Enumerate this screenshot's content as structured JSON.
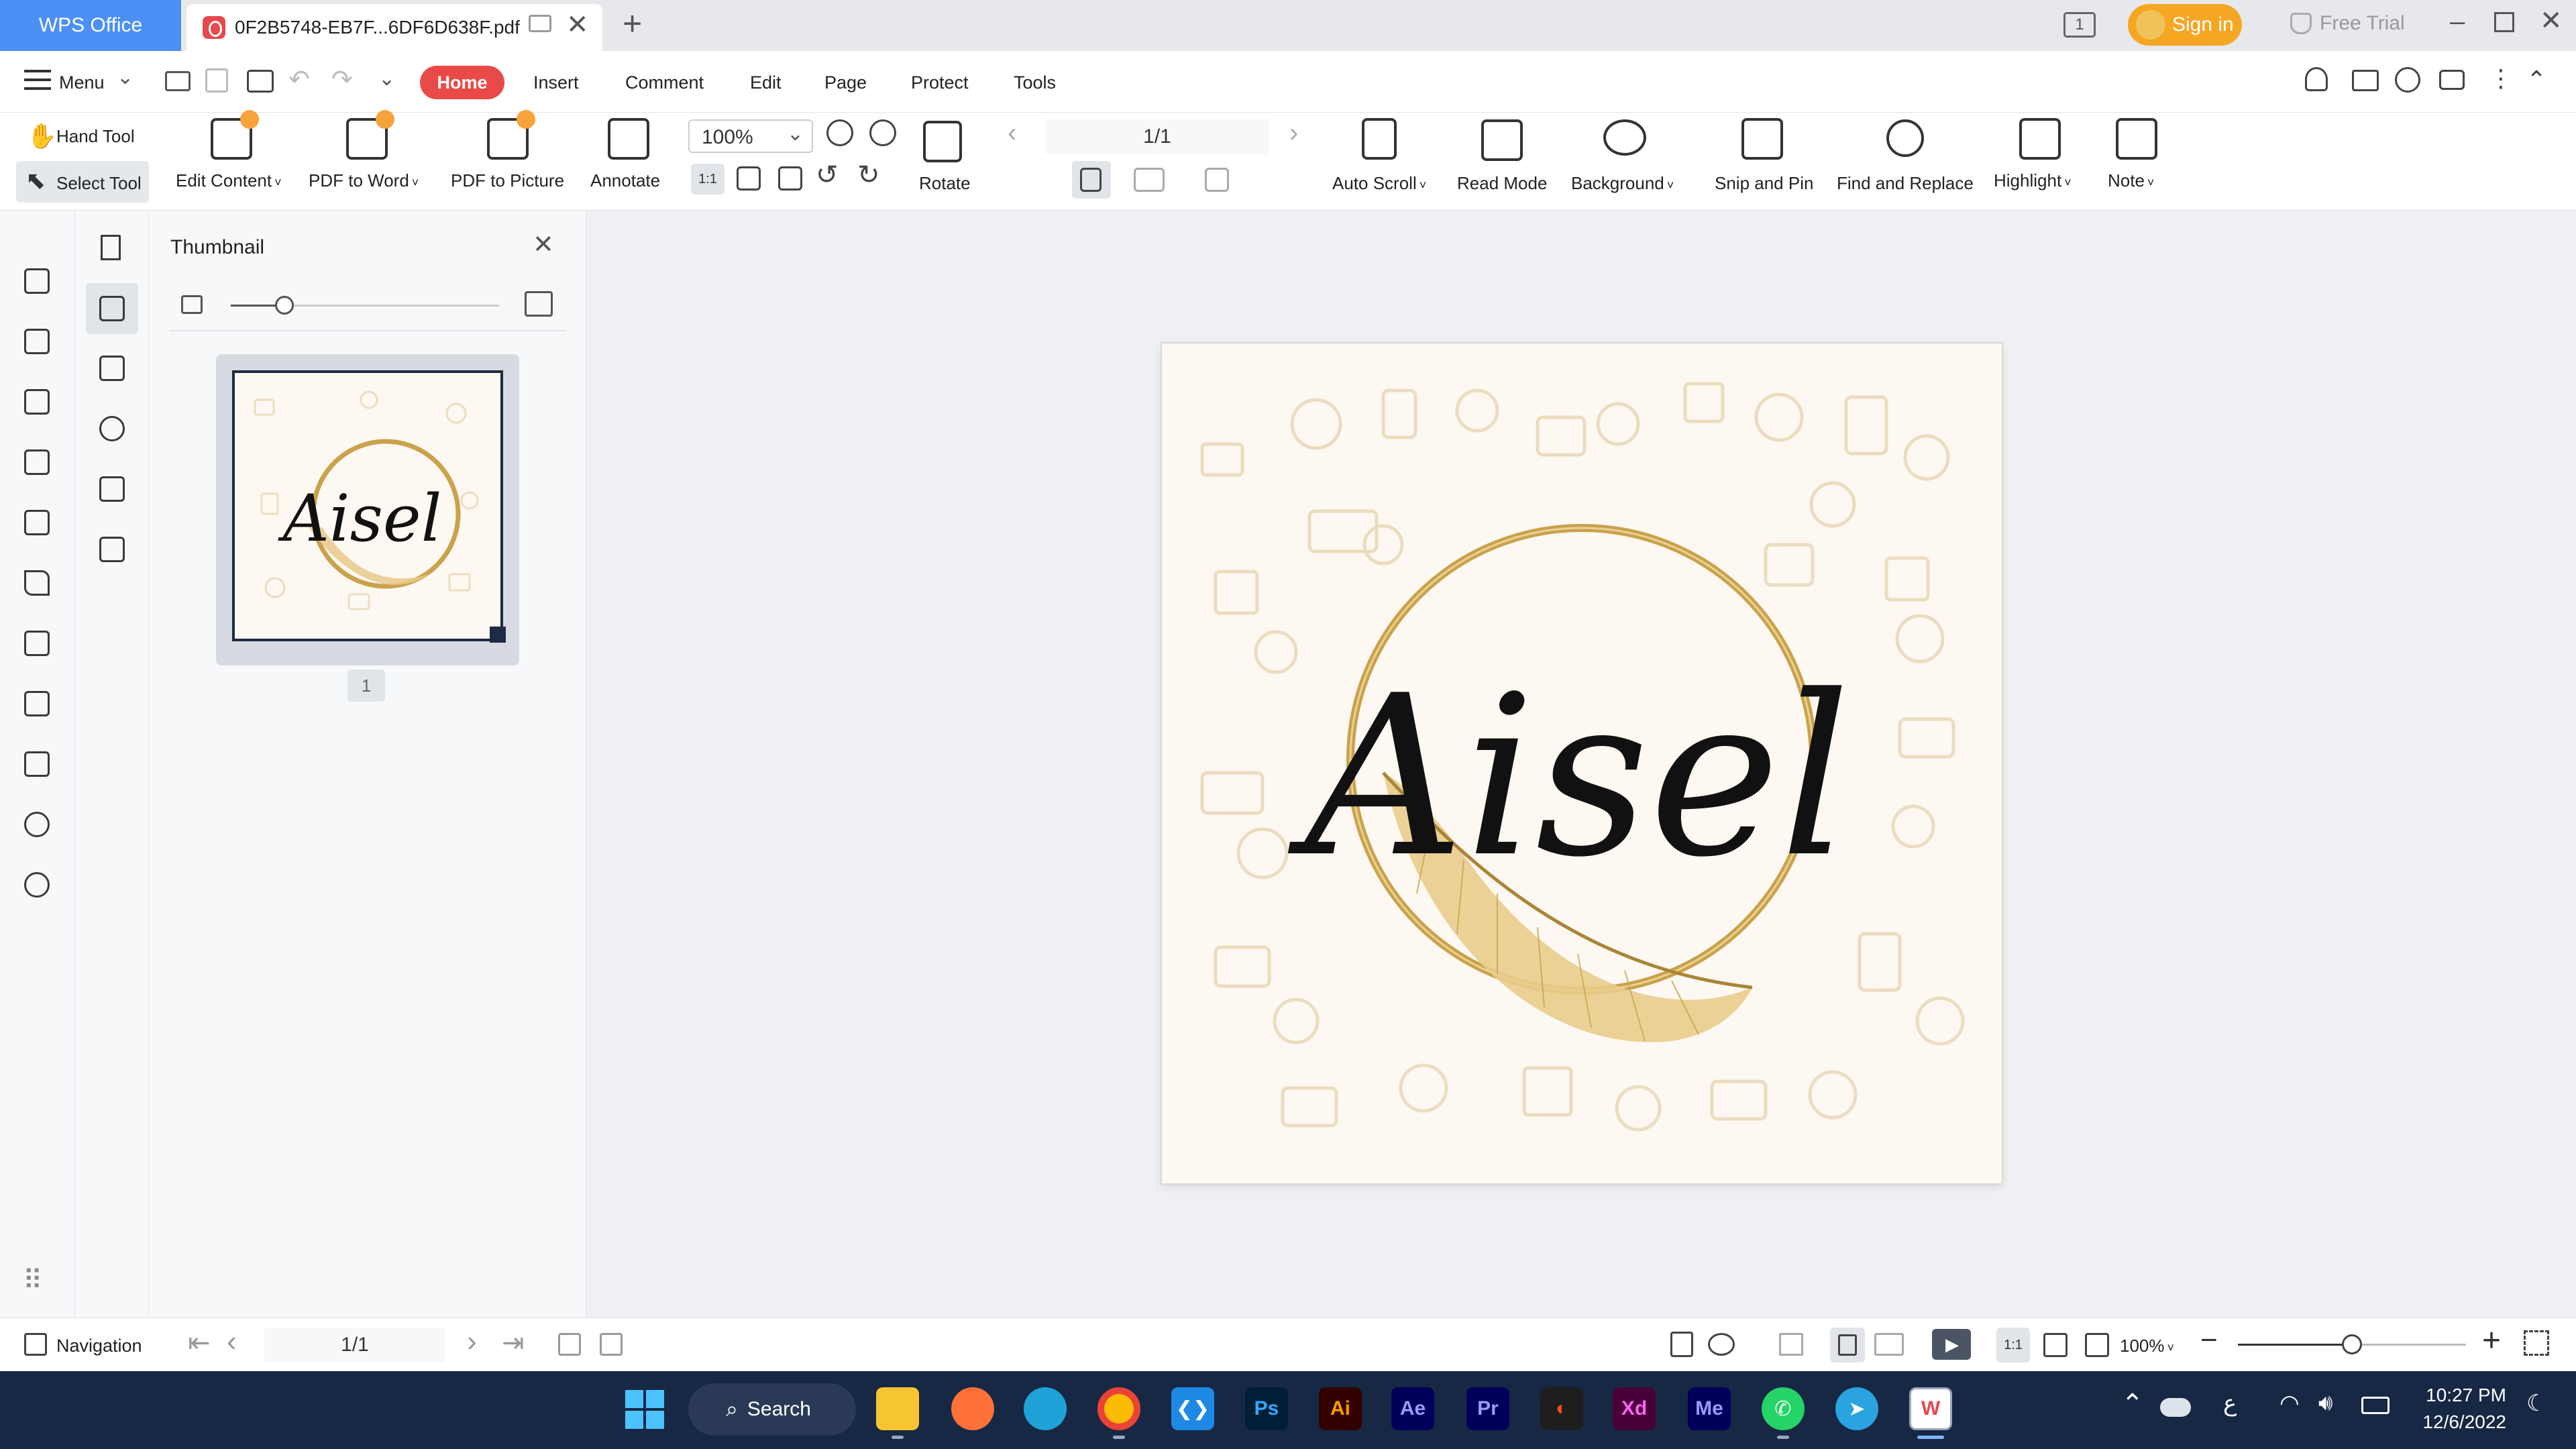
{
  "window": {
    "brand_tab": "WPS Office",
    "doc_tab": "0F2B5748-EB7F...6DF6D638F.pdf",
    "sign_in": "Sign in",
    "free_trial": "Free Trial",
    "page_badge": "1"
  },
  "menu": {
    "menu_label": "Menu",
    "tabs": [
      "Home",
      "Insert",
      "Comment",
      "Edit",
      "Page",
      "Protect",
      "Tools"
    ]
  },
  "ribbon": {
    "hand_tool": "Hand Tool",
    "select_tool": "Select Tool",
    "edit_content": "Edit Content",
    "pdf_to_word": "PDF to Word",
    "pdf_to_picture": "PDF to Picture",
    "annotate": "Annotate",
    "zoom": "100%",
    "rotate": "Rotate",
    "page_indicator": "1/1",
    "auto_scroll": "Auto Scroll",
    "read_mode": "Read Mode",
    "background": "Background",
    "snip_and_pin": "Snip and Pin",
    "find_and_replace": "Find and Replace",
    "highlight": "Highlight",
    "note": "Note",
    "fit_label": "1:1"
  },
  "thumbnail_panel": {
    "title": "Thumbnail",
    "page_number": "1",
    "thumb_text": "Aisel",
    "slider_value_fraction": 0.2
  },
  "document": {
    "logo_text": "Aisel"
  },
  "statusbar": {
    "navigation": "Navigation",
    "page_field": "1/1",
    "zoom": "100%",
    "zoom_slider_fraction": 0.5,
    "fit_label": "1:1"
  },
  "taskbar": {
    "search": "Search",
    "apps": [
      "Ps",
      "Ai",
      "Ae",
      "Pr",
      "Xd",
      "Me"
    ],
    "time": "10:27 PM",
    "date": "12/6/2022",
    "lang": "ع"
  },
  "colors": {
    "accent": "#e94a47",
    "brand_blue": "#4c8ff5",
    "sign_in": "#f5a623",
    "taskbar": "#172844",
    "gold": "#c9a24b"
  }
}
